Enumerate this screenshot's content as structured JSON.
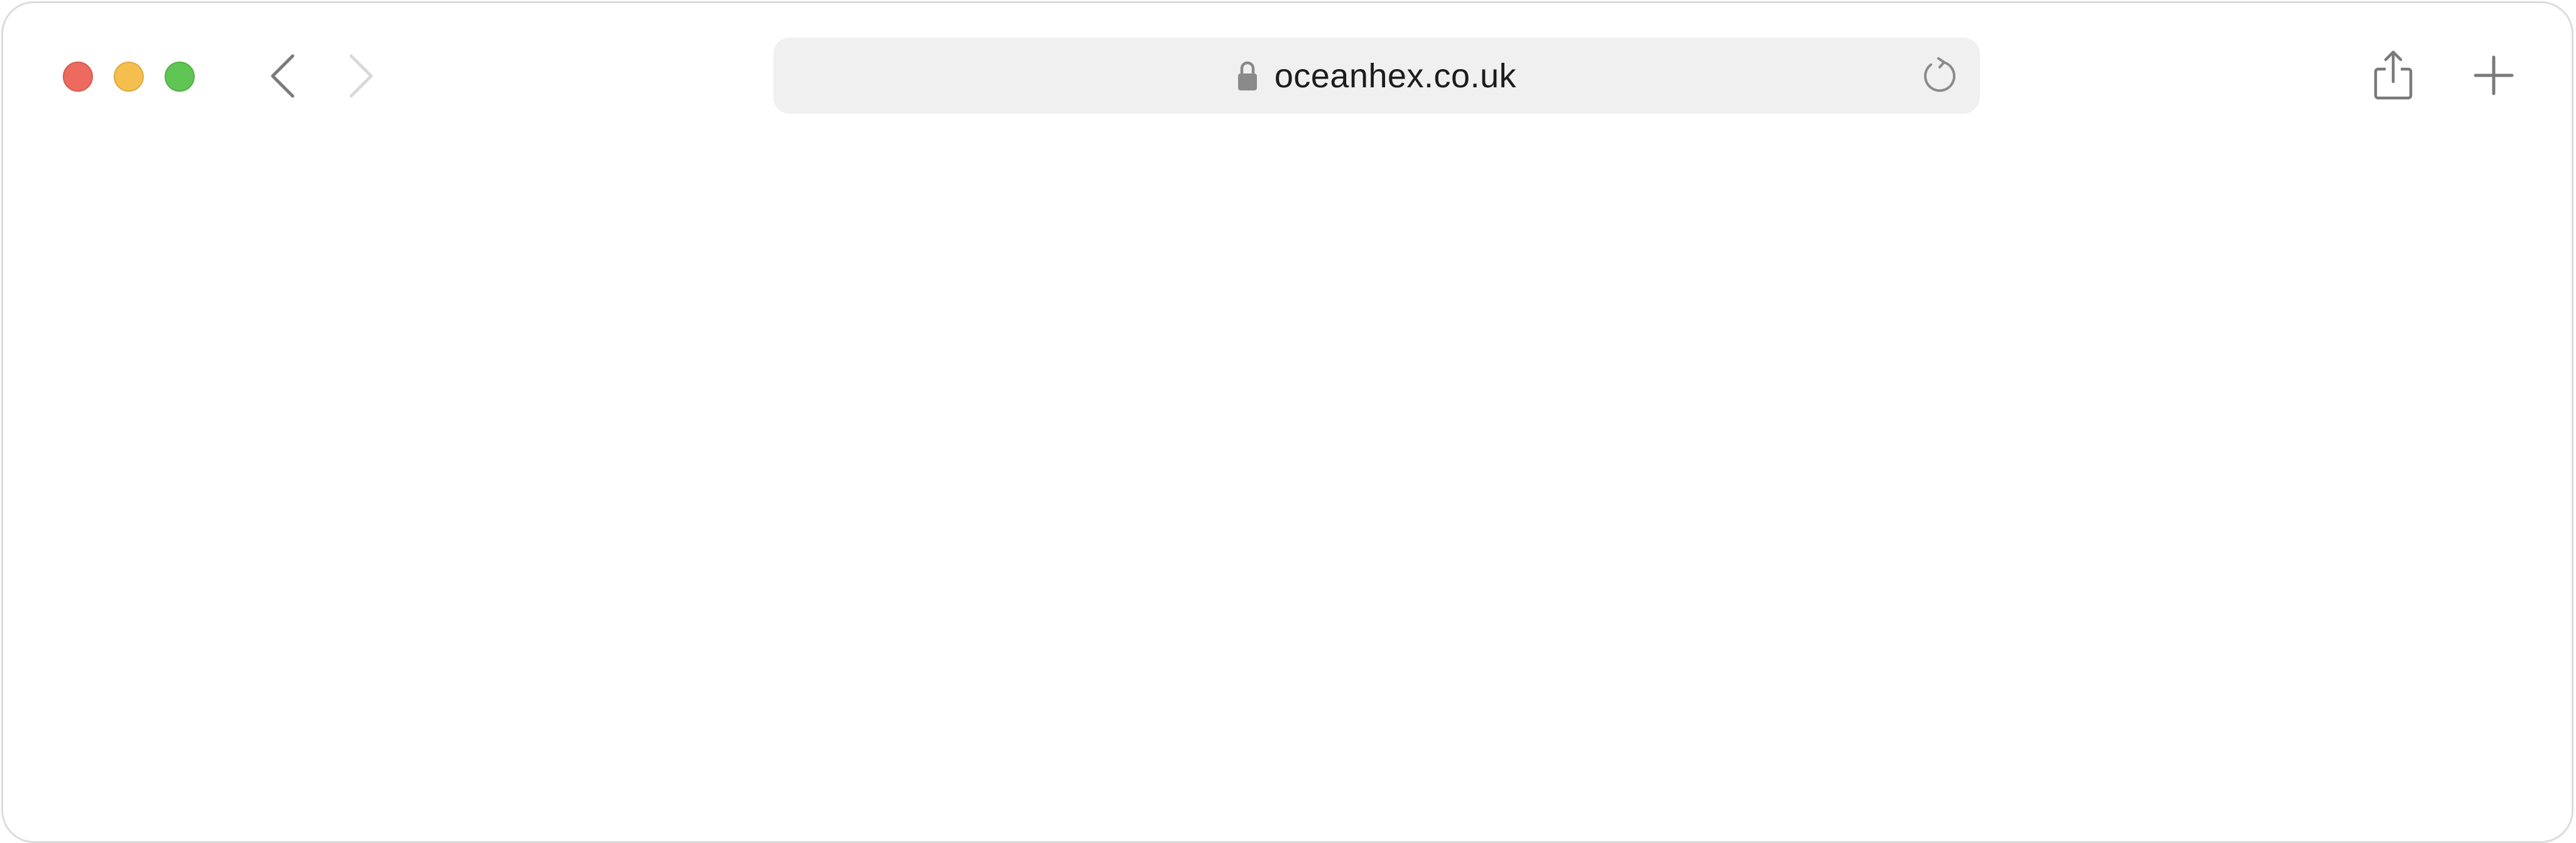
{
  "browser": {
    "address_bar": {
      "url": "oceanhex.co.uk",
      "secure": true
    },
    "traffic_lights": {
      "close_color": "#ed6a5e",
      "minimize_color": "#f5bf4f",
      "zoom_color": "#61c554"
    },
    "navigation": {
      "back_enabled": true,
      "forward_enabled": false
    },
    "icons": {
      "lock": "lock-icon",
      "reload": "reload-icon",
      "share": "share-icon",
      "new_tab": "plus-icon",
      "back": "chevron-left-icon",
      "forward": "chevron-right-icon"
    }
  }
}
